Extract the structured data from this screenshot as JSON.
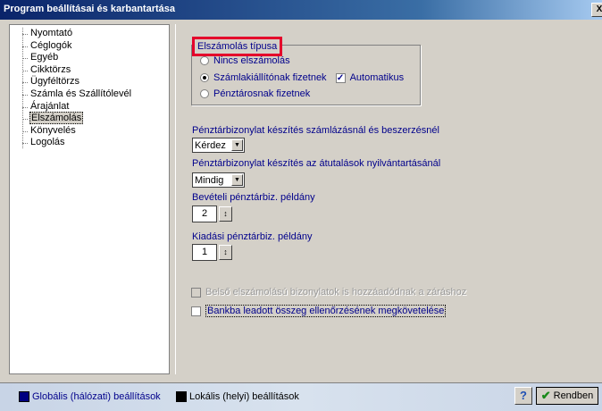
{
  "window": {
    "title": "Program beállításai és karbantartása",
    "close_label": "X"
  },
  "tree": {
    "items": [
      "Nyomtató",
      "Céglogók",
      "Egyéb",
      "Cikktörzs",
      "Ügyféltörzs",
      "Számla és Szállítólevél",
      "Árajánlat",
      "Elszámolás",
      "Könyvelés",
      "Logolás"
    ],
    "selected": "Elszámolás"
  },
  "settlement": {
    "group_title": "Elszámolás típusa",
    "radio_none": "Nincs elszámolás",
    "radio_issuer": "Számlakiállítónak fizetnek",
    "auto_label": "Automatikus",
    "radio_cashier": "Pénztárosnak fizetnek",
    "selected": "radio_issuer",
    "auto_checked": true
  },
  "invoice_receipt": {
    "label": "Pénztárbizonylat készítés számlázásnál és beszerzésnél",
    "value": "Kérdez"
  },
  "transfer_receipt": {
    "label": "Pénztárbizonylat készítés az átutalások nyilvántartásánál",
    "value": "Mindig"
  },
  "income_copies": {
    "label": "Bevételi pénztárbiz. példány",
    "value": "2"
  },
  "expense_copies": {
    "label": "Kiadási pénztárbiz. példány",
    "value": "1"
  },
  "internal_docs": {
    "label": "Belső elszámolású bizonylatok is hozzáadódnak a záráshoz",
    "checked": false,
    "disabled": true
  },
  "bank_check": {
    "label": "Bankba leadott összeg ellenőrzésének megkövetelése",
    "checked": false
  },
  "footer": {
    "global_label": "Globális (hálózati) beállítások",
    "global_color": "#000080",
    "local_label": "Lokális (helyi) beállítások",
    "local_color": "#000000",
    "help_label": "?",
    "ok_label": "Rendben",
    "ok_icon": "checkmark-icon"
  }
}
